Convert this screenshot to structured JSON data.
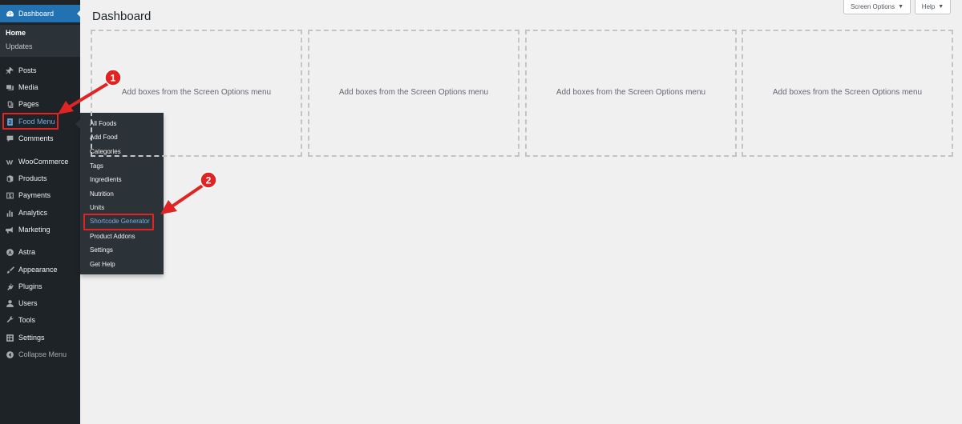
{
  "sidebar": {
    "dashboard": "Dashboard",
    "dashboard_sub": {
      "home": "Home",
      "updates": "Updates"
    },
    "items": [
      {
        "label": "Posts",
        "icon": "pushpin-icon"
      },
      {
        "label": "Media",
        "icon": "media-icon"
      },
      {
        "label": "Pages",
        "icon": "pages-icon"
      },
      {
        "label": "Food Menu",
        "icon": "food-menu-icon"
      },
      {
        "label": "Comments",
        "icon": "comments-icon"
      },
      {
        "label": "WooCommerce",
        "icon": "woocommerce-icon"
      },
      {
        "label": "Products",
        "icon": "products-icon"
      },
      {
        "label": "Payments",
        "icon": "payments-icon"
      },
      {
        "label": "Analytics",
        "icon": "analytics-icon"
      },
      {
        "label": "Marketing",
        "icon": "megaphone-icon"
      },
      {
        "label": "Astra",
        "icon": "astra-icon"
      },
      {
        "label": "Appearance",
        "icon": "paintbrush-icon"
      },
      {
        "label": "Plugins",
        "icon": "plugin-icon"
      },
      {
        "label": "Users",
        "icon": "users-icon"
      },
      {
        "label": "Tools",
        "icon": "wrench-icon"
      },
      {
        "label": "Settings",
        "icon": "settings-icon"
      }
    ],
    "collapse": "Collapse Menu"
  },
  "flyout": [
    "All Foods",
    "Add Food",
    "Categories",
    "Tags",
    "Ingredients",
    "Nutrition",
    "Units",
    "Shortcode Generator",
    "Product Addons",
    "Settings",
    "Get Help"
  ],
  "header": {
    "title": "Dashboard",
    "screen_options": "Screen Options",
    "help": "Help"
  },
  "boxes": [
    "Add boxes from the Screen Options menu",
    "Add boxes from the Screen Options menu",
    "Add boxes from the Screen Options menu",
    "Add boxes from the Screen Options menu"
  ],
  "annotations": {
    "step1": "1",
    "step2": "2"
  },
  "colors": {
    "sidebar": "#1d2327",
    "submenu": "#2c3338",
    "accent": "#2271b1",
    "annotation_red": "#e02424"
  }
}
